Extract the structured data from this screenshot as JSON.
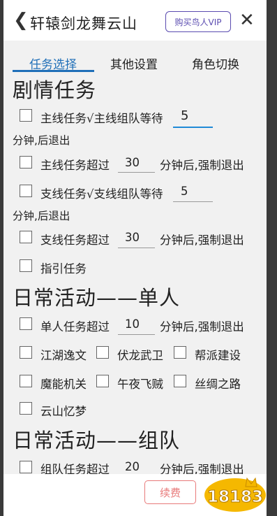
{
  "header": {
    "back_icon": "chevron-left",
    "title": "轩辕剑龙舞云山",
    "vip_button": "购买鸟人VIP",
    "close_icon": "close"
  },
  "tabs": [
    {
      "label": "任务选择",
      "active": true
    },
    {
      "label": "其他设置",
      "active": false
    },
    {
      "label": "角色切换",
      "active": false
    }
  ],
  "sections": {
    "story": "剧情任务",
    "daily_solo": "日常活动——单人",
    "daily_team": "日常活动——组队"
  },
  "story": {
    "main_task": "主线任务√主线组队等待",
    "main_wait_value": "5",
    "main_wait_suffix": "分钟,后退出",
    "main_timeout_label": "主线任务超过",
    "main_timeout_value": "30",
    "main_timeout_suffix": "分钟后,强制退出",
    "side_task": "支线任务√支线组队等待",
    "side_wait_value": "5",
    "side_wait_suffix": "分钟,后退出",
    "side_timeout_label": "支线任务超过",
    "side_timeout_value": "30",
    "side_timeout_suffix": "分钟后,强制退出",
    "guide_task": "指引任务"
  },
  "solo": {
    "timeout_label": "单人任务超过",
    "timeout_value": "10",
    "timeout_suffix": "分钟后,强制退出",
    "items": [
      "江湖逸文",
      "伏龙武卫",
      "帮派建设",
      "魔能机关",
      "午夜飞贼",
      "丝绸之路",
      "云山忆梦"
    ]
  },
  "team": {
    "timeout_label": "组队任务超过",
    "timeout_value": "20",
    "timeout_suffix": "分钟后,强制退出"
  },
  "footer": {
    "renew_button": "续费",
    "logo_text": "18183"
  },
  "colors": {
    "accent": "#1f6fb8",
    "vip": "#5a4bb0",
    "renew": "#e87a7a",
    "logo": "#f5b800"
  }
}
